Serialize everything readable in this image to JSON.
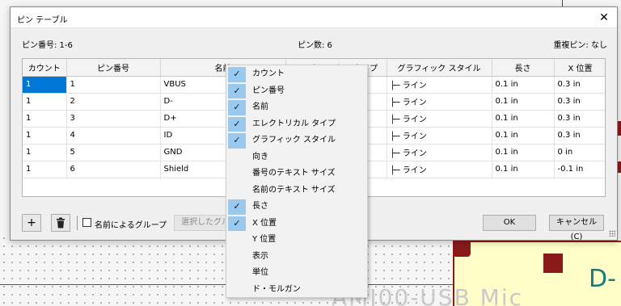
{
  "dialog": {
    "title": "ピン テーブル",
    "close_icon": "close-icon",
    "pin_numbers_text": "ピン番号: 1-6",
    "pin_count_text": "ピン数: 6",
    "duplicate_pins_text": "重複ピン: なし"
  },
  "table": {
    "headers": [
      "カウント",
      "ピン番号",
      "名前",
      "エレクトリカル タイプ",
      "グラフィック スタイル",
      "長さ",
      "X 位置"
    ],
    "rows": [
      {
        "count": "1",
        "number": "1",
        "name": "VBUS",
        "gs_glyph": "├─",
        "gs": "ライン",
        "length": "0.1 in",
        "x": "0.3 in"
      },
      {
        "count": "1",
        "number": "2",
        "name": "D-",
        "gs_glyph": "├─",
        "gs": "ライン",
        "length": "0.1 in",
        "x": "0.3 in"
      },
      {
        "count": "1",
        "number": "3",
        "name": "D+",
        "gs_glyph": "├─",
        "gs": "ライン",
        "length": "0.1 in",
        "x": "0.3 in"
      },
      {
        "count": "1",
        "number": "4",
        "name": "ID",
        "gs_glyph": "├─",
        "gs": "ライン",
        "length": "0.1 in",
        "x": "0.3 in"
      },
      {
        "count": "1",
        "number": "5",
        "name": "GND",
        "gs_glyph": "├─",
        "gs": "ライン",
        "length": "0.1 in",
        "x": "0 in"
      },
      {
        "count": "1",
        "number": "6",
        "name": "Shield",
        "gs_glyph": "├─",
        "gs": "ライン",
        "length": "0.1 in",
        "x": "-0.1 in"
      }
    ]
  },
  "bottom": {
    "add_label": "+",
    "delete_icon": "trash-icon",
    "group_by_name_label": "名前によるグループ",
    "group_selected_label": "選択したグループ",
    "ok_label": "OK",
    "cancel_label": "キャンセル (C)"
  },
  "context_menu": {
    "items": [
      {
        "label": "カウント",
        "checked": true
      },
      {
        "label": "ピン番号",
        "checked": true
      },
      {
        "label": "名前",
        "checked": true
      },
      {
        "label": "エレクトリカル タイプ",
        "checked": true
      },
      {
        "label": "グラフィック スタイル",
        "checked": true
      },
      {
        "label": "向き",
        "checked": false
      },
      {
        "label": "番号のテキスト サイズ",
        "checked": false
      },
      {
        "label": "名前のテキスト サイズ",
        "checked": false
      },
      {
        "label": "長さ",
        "checked": true
      },
      {
        "label": "X 位置",
        "checked": true
      },
      {
        "label": "Y 位置",
        "checked": false
      },
      {
        "label": "表示",
        "checked": false
      },
      {
        "label": "単位",
        "checked": false
      },
      {
        "label": "ド・モルガン",
        "checked": false
      }
    ],
    "check_glyph": "✓"
  },
  "schematic": {
    "part_text": "AMJ00-USB Mic",
    "pin_label": "D-",
    "colors": {
      "wire": "#555555",
      "body": "#fffec8",
      "pad": "#8a1a1a",
      "accent": "#1b7a7a"
    }
  },
  "colors": {
    "selection": "#0078d7",
    "menu_check_bg": "#99c9ef"
  }
}
